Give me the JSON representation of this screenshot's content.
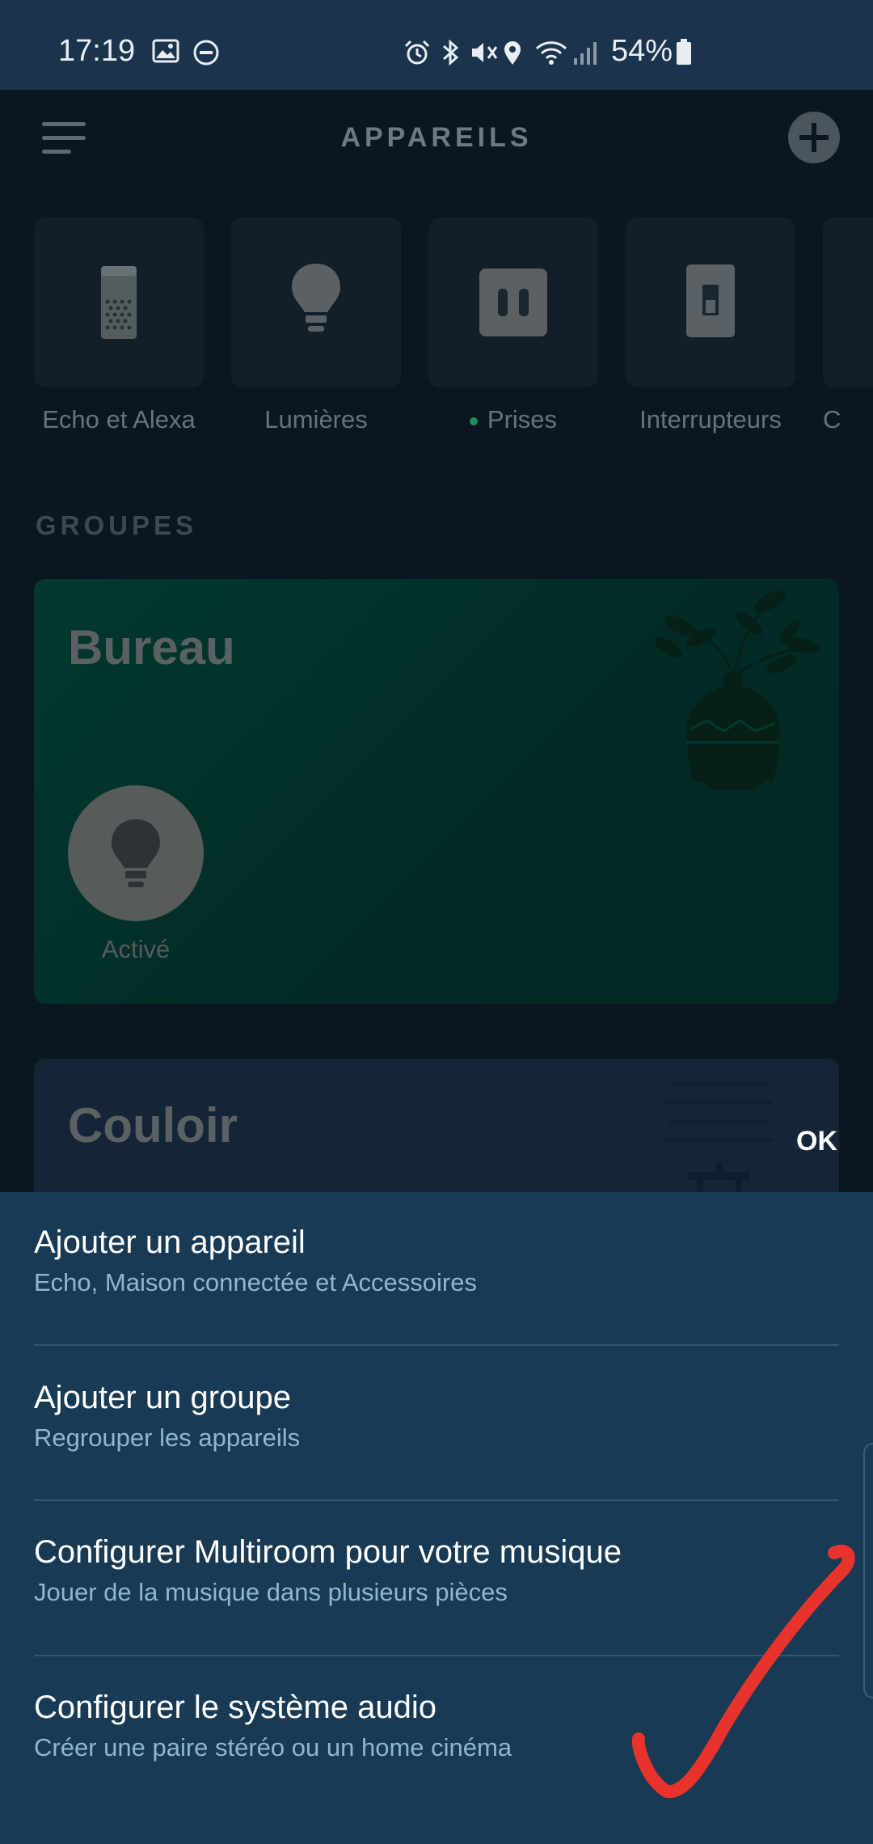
{
  "status_bar": {
    "time": "17:19",
    "battery": "54%",
    "icons": [
      "image-icon",
      "dnd-icon",
      "alarm-icon",
      "bluetooth-icon",
      "vibrate-icon",
      "location-icon",
      "wifi-icon",
      "signal-icon",
      "battery-icon"
    ]
  },
  "header": {
    "title": "APPAREILS",
    "menu_icon": "hamburger-menu-icon",
    "add_icon": "plus-circle-icon"
  },
  "categories": [
    {
      "label": "Echo et Alexa",
      "icon": "echo-speaker-icon"
    },
    {
      "label": "Lumières",
      "icon": "lightbulb-icon"
    },
    {
      "label": "Prises",
      "icon": "plug-icon",
      "status_dot": true
    },
    {
      "label": "Interrupteurs",
      "icon": "switch-icon"
    },
    {
      "label": "C",
      "icon": "camera-icon"
    }
  ],
  "groups_section": {
    "label": "GROUPES",
    "groups": [
      {
        "name": "Bureau",
        "device_status": "Activé",
        "device_icon": "lightbulb-icon",
        "illustration": "plant-vase-illustration"
      },
      {
        "name": "Couloir",
        "illustration": "shelf-illustration"
      }
    ]
  },
  "overlay": {
    "ok_label": "OK"
  },
  "sheet": {
    "items": [
      {
        "title": "Ajouter un appareil",
        "subtitle": "Echo, Maison connectée et Accessoires"
      },
      {
        "title": "Ajouter un groupe",
        "subtitle": "Regrouper les appareils"
      },
      {
        "title": "Configurer Multiroom pour votre musique",
        "subtitle": "Jouer de la musique dans plusieurs pièces"
      },
      {
        "title": "Configurer le système audio",
        "subtitle": "Créer une paire stéréo ou un home cinéma"
      }
    ]
  },
  "annotation": {
    "mark": "red-checkmark",
    "color": "#e8332c"
  },
  "colors": {
    "sheet_background": "#183a54",
    "status_bar": "#19344c",
    "bureau_card": "#02392f",
    "subtitle_text": "#8fb6d4"
  }
}
